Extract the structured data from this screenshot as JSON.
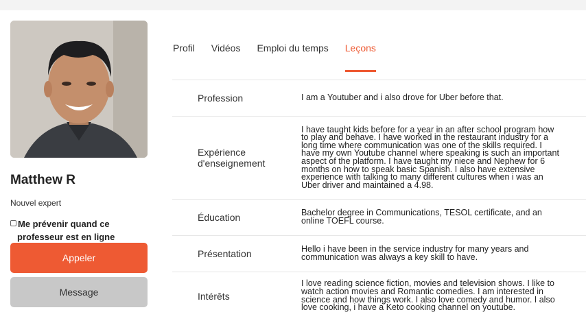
{
  "profile": {
    "name": "Matthew R",
    "subtitle": "Nouvel expert",
    "notify_line1": "Me prévenir quand ce",
    "notify_line2": "professeur est en ligne",
    "call_label": "Appeler",
    "message_label": "Message"
  },
  "tabs": [
    {
      "label": "Profil",
      "active": false
    },
    {
      "label": "Vidéos",
      "active": false
    },
    {
      "label": "Emploi du temps",
      "active": false
    },
    {
      "label": "Leçons",
      "active": true
    }
  ],
  "colors": {
    "accent": "#ee5a33",
    "secondary_button": "#c8c8c8"
  },
  "details": [
    {
      "label": "Profession",
      "value": "I am a Youtuber and i also drove for Uber before that."
    },
    {
      "label": "Expérience d'enseignement",
      "value": "I have taught kids before for a year in an after school program how to play and behave. I have worked in the restaurant industry for a long time where communication was one of the skills required. I have my own Youtube channel where speaking is such an important aspect of the platform. I have taught my niece and Nephew for 6 months on how to speak basic Spanish. I also have extensive experience with talking to many different cultures when i was an Uber driver and maintained a 4.98."
    },
    {
      "label": "Éducation",
      "value": "Bachelor degree in Communications, TESOL certificate, and an online TOEFL course."
    },
    {
      "label": "Présentation",
      "value": "Hello i have been in the service industry for many years and communication was always a key skill to have."
    },
    {
      "label": "Intérêts",
      "value": "I love reading science fiction, movies and television shows. I like to watch action movies and Romantic comedies. I am interested in science and how things work. I also love comedy and humor. I also love cooking, i have a Keto cooking channel on youtube."
    }
  ]
}
